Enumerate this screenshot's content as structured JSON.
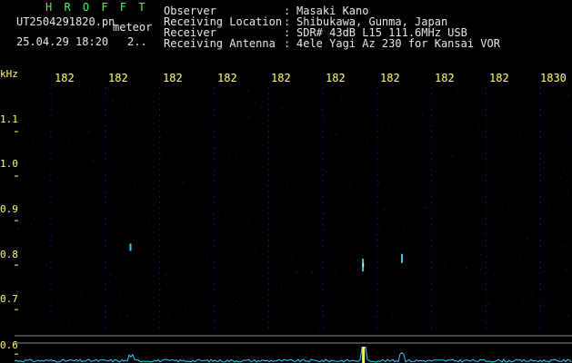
{
  "app": {
    "title": "H R O F F T",
    "file_name": "UT2504291820.pn",
    "mode_label": "meteor",
    "datetime": "25.04.29 18:20",
    "count": "2.."
  },
  "header": {
    "rows": [
      {
        "label": "Observer",
        "value": "Masaki Kano"
      },
      {
        "label": "Receiving Location",
        "value": "Shibukawa, Gunma, Japan"
      },
      {
        "label": "Receiver",
        "value": "SDR# 43dB L15 111.6MHz USB"
      },
      {
        "label": "Receiving Antenna",
        "value": "4ele Yagi Az 230 for Kansai VOR"
      }
    ],
    "separator": ":"
  },
  "axes": {
    "freq_unit": "kHz",
    "x_ticks": [
      "182",
      "182",
      "182",
      "182",
      "182",
      "182",
      "182",
      "182",
      "182",
      "1830"
    ],
    "y_ticks": [
      "1.1",
      "1.0",
      "0.9",
      "0.8",
      "0.7",
      "0.6"
    ],
    "y_tick_values": [
      1.1,
      1.0,
      0.9,
      0.8,
      0.7,
      0.6
    ],
    "y_range": [
      0.58,
      1.2
    ]
  },
  "colors": {
    "background": "#000000",
    "title_green": "#33ff66",
    "tick_yellow": "#ffff66",
    "grid_blue": "#0a1a66",
    "signal_cyan": "#33ccff",
    "signal_yellow": "#ffff66",
    "baseline_white": "#bbbbbb"
  },
  "echoes": [
    {
      "x_fraction": 0.625,
      "freq": 0.8,
      "strength": 1.0
    },
    {
      "x_fraction": 0.695,
      "freq": 0.815,
      "strength": 0.6
    },
    {
      "x_fraction": 0.208,
      "freq": 0.84,
      "strength": 0.4
    }
  ]
}
